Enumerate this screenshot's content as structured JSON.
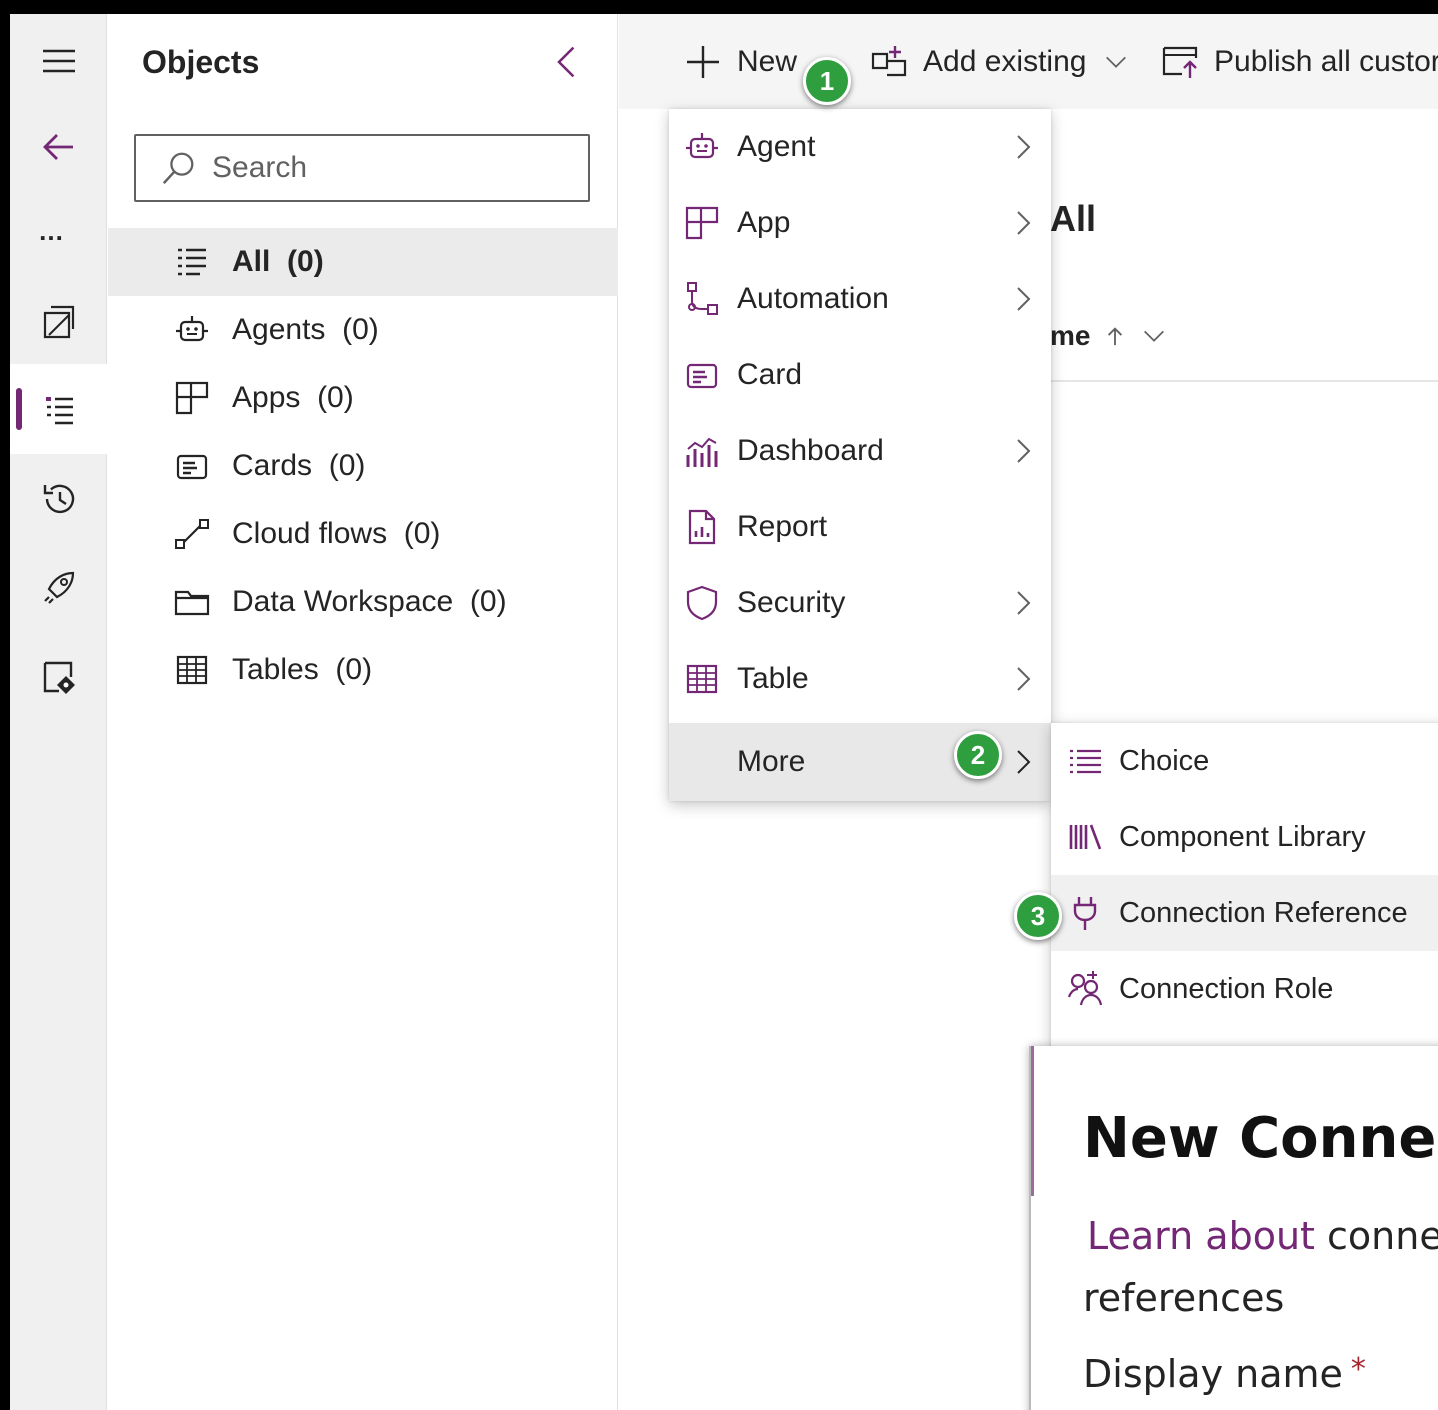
{
  "colors": {
    "accent": "#742774",
    "badge": "#2e9e3e",
    "required": "#a4262c"
  },
  "rail": {
    "items": [
      {
        "icon": "hamburger-icon"
      },
      {
        "icon": "back-arrow-icon"
      },
      {
        "icon": "more-icon",
        "label": "..."
      },
      {
        "icon": "solution-icon"
      },
      {
        "icon": "objects-icon",
        "active": true
      },
      {
        "icon": "history-icon"
      },
      {
        "icon": "deploy-icon"
      },
      {
        "icon": "source-control-icon"
      }
    ]
  },
  "objects_pane": {
    "title": "Objects",
    "search_placeholder": "Search",
    "items": [
      {
        "label": "All",
        "count": "(0)",
        "icon": "list-icon",
        "selected": true
      },
      {
        "label": "Agents",
        "count": "(0)",
        "icon": "agent-icon"
      },
      {
        "label": "Apps",
        "count": "(0)",
        "icon": "app-icon"
      },
      {
        "label": "Cards",
        "count": "(0)",
        "icon": "card-icon"
      },
      {
        "label": "Cloud flows",
        "count": "(0)",
        "icon": "flow-icon"
      },
      {
        "label": "Data Workspace",
        "count": "(0)",
        "icon": "folder-icon"
      },
      {
        "label": "Tables",
        "count": "(0)",
        "icon": "table-icon"
      }
    ]
  },
  "toolbar": {
    "new_label": "New",
    "add_existing_label": "Add existing",
    "publish_label": "Publish all custor"
  },
  "main": {
    "title": "All",
    "column_header": "me"
  },
  "new_menu": {
    "items": [
      {
        "label": "Agent",
        "icon": "agent-icon",
        "submenu": true
      },
      {
        "label": "App",
        "icon": "app-icon",
        "submenu": true
      },
      {
        "label": "Automation",
        "icon": "automation-icon",
        "submenu": true
      },
      {
        "label": "Card",
        "icon": "card-icon",
        "submenu": false
      },
      {
        "label": "Dashboard",
        "icon": "dashboard-icon",
        "submenu": true
      },
      {
        "label": "Report",
        "icon": "report-icon",
        "submenu": false
      },
      {
        "label": "Security",
        "icon": "shield-icon",
        "submenu": true
      },
      {
        "label": "Table",
        "icon": "table-icon",
        "submenu": true
      },
      {
        "label": "More",
        "icon": "",
        "submenu": true
      }
    ]
  },
  "more_submenu": {
    "items": [
      {
        "label": "Choice",
        "icon": "choice-icon"
      },
      {
        "label": "Component Library",
        "icon": "library-icon"
      },
      {
        "label": "Connection Reference",
        "icon": "plug-icon"
      },
      {
        "label": "Connection Role",
        "icon": "people-icon"
      }
    ]
  },
  "badges": {
    "step1": "1",
    "step2": "2",
    "step3": "3"
  },
  "dialog": {
    "title": "New Connec",
    "learn_link": "Learn about",
    "learn_rest": "conne",
    "learn_line2": "references",
    "field_label": "Display name",
    "required_mark": "*"
  }
}
